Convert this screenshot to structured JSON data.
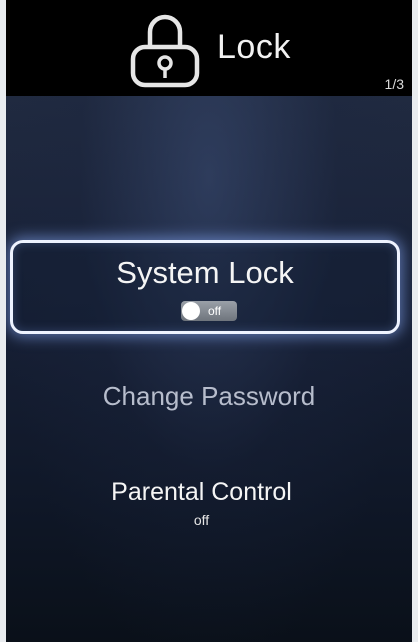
{
  "header": {
    "icon": "lock-icon",
    "title": "Lock",
    "page_indicator": "1/3"
  },
  "menu": {
    "system_lock": {
      "label": "System Lock",
      "toggle_state": "off",
      "selected": true
    },
    "change_password": {
      "label": "Change Password"
    },
    "parental_control": {
      "label": "Parental Control",
      "status": "off"
    }
  },
  "colors": {
    "header_background": "#000000",
    "screen_background": "#172036",
    "selection_border": "#eef3ff",
    "selection_glow": "#8cafff",
    "dimmed_text": "#b7bdcc"
  }
}
